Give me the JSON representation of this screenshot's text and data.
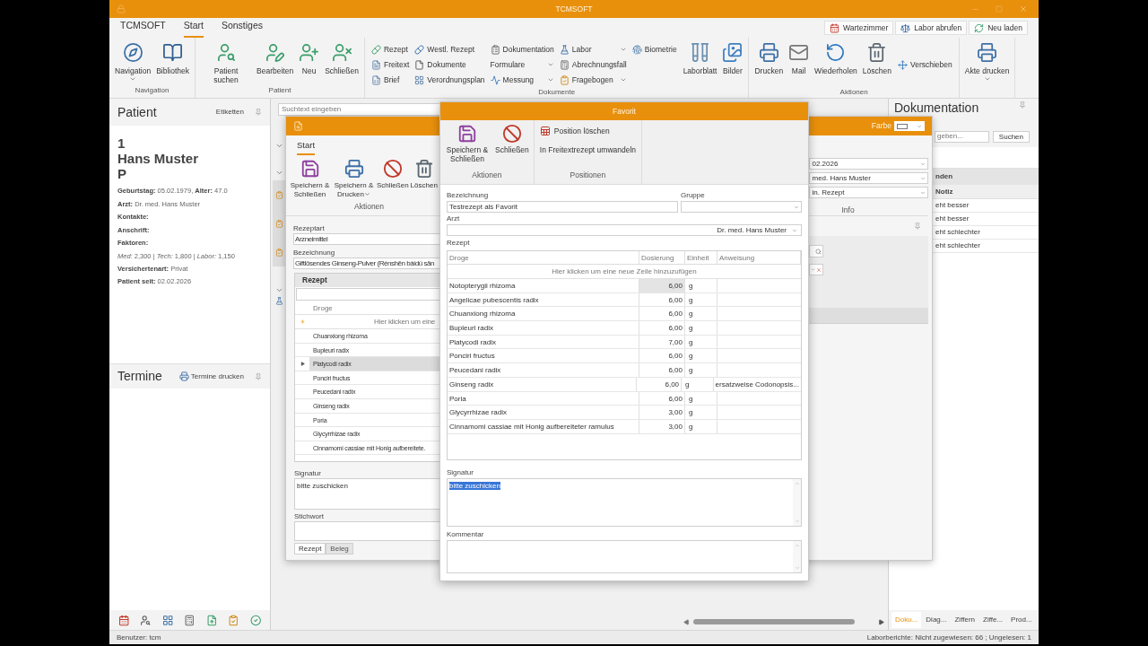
{
  "window": {
    "title": "TCMSOFT"
  },
  "ribbon": {
    "tabs": [
      {
        "label": "TCMSOFT",
        "selected": false
      },
      {
        "label": "Start",
        "selected": true
      },
      {
        "label": "Sonstiges",
        "selected": false
      }
    ],
    "quick_buttons": [
      {
        "label": "Wartezimmer"
      },
      {
        "label": "Labor abrufen"
      },
      {
        "label": "Neu laden"
      }
    ],
    "groups": [
      {
        "label": "Navigation",
        "items": [
          {
            "kind": "large",
            "label": "Navigation",
            "dropdown": true
          },
          {
            "kind": "large",
            "label": "Bibliothek",
            "dropdown": false
          }
        ]
      },
      {
        "label": "Patient",
        "items": [
          {
            "kind": "large",
            "label": "Patient suchen",
            "dropdown": false
          },
          {
            "kind": "large",
            "label": "Bearbeiten",
            "dropdown": false
          },
          {
            "kind": "large",
            "label": "Neu",
            "dropdown": false
          },
          {
            "kind": "large",
            "label": "Schließen",
            "dropdown": false
          }
        ]
      },
      {
        "label": "Dokumente",
        "items": [
          {
            "kind": "small",
            "label": "Rezept",
            "dropdown": false
          },
          {
            "kind": "small",
            "label": "Freitext",
            "dropdown": false
          },
          {
            "kind": "small",
            "label": "Brief",
            "dropdown": false
          },
          {
            "kind": "small",
            "label": "Westl. Rezept",
            "dropdown": false
          },
          {
            "kind": "small",
            "label": "Dokumente",
            "dropdown": false
          },
          {
            "kind": "small",
            "label": "Verordnungsplan",
            "dropdown": false
          },
          {
            "kind": "small",
            "label": "Dokumentation",
            "dropdown": false
          },
          {
            "kind": "small",
            "label": "Formulare",
            "dropdown": true
          },
          {
            "kind": "small",
            "label": "Messung",
            "dropdown": true
          },
          {
            "kind": "small",
            "label": "Labor",
            "dropdown": true
          },
          {
            "kind": "small",
            "label": "Abrechnungsfall",
            "dropdown": false
          },
          {
            "kind": "small",
            "label": "Fragebogen",
            "dropdown": true
          },
          {
            "kind": "small",
            "label": "Biometrie",
            "dropdown": false
          },
          {
            "kind": "large",
            "label": "Laborblatt",
            "dropdown": false
          },
          {
            "kind": "large",
            "label": "Bilder",
            "dropdown": false
          }
        ]
      },
      {
        "label": "Aktionen",
        "items": [
          {
            "kind": "large",
            "label": "Drucken",
            "dropdown": false
          },
          {
            "kind": "large",
            "label": "Mail",
            "dropdown": false
          },
          {
            "kind": "large",
            "label": "Wiederholen",
            "dropdown": false
          },
          {
            "kind": "large",
            "label": "Löschen",
            "dropdown": false
          },
          {
            "kind": "small",
            "label": "Verschieben",
            "dropdown": false
          }
        ]
      },
      {
        "items": [
          {
            "kind": "large",
            "label": "Akte drucken",
            "dropdown": true
          }
        ]
      }
    ]
  },
  "patient_panel": {
    "title": "Patient",
    "action": "Etiketten",
    "number": "1",
    "name": "Hans Muster",
    "type": "P",
    "details": [
      {
        "kind": "field",
        "text": "**Geburtstag:** 05.02.1979, **Alter:** 47.0"
      },
      {
        "kind": "field",
        "text": "**Arzt:** Dr. med. Hans Muster"
      },
      {
        "kind": "field",
        "text": "**Kontakte:**"
      },
      {
        "kind": "field",
        "text": "**Anschrift:**"
      },
      {
        "kind": "field",
        "text": "**Faktoren:**"
      },
      {
        "kind": "continuation",
        "text": "*Med:* 2,300 | *Tech:* 1,800 | *Labor:* 1,150"
      },
      {
        "kind": "field",
        "text": "**Versichertenart:** Privat"
      },
      {
        "kind": "field",
        "text": "**Patient seit:** 02.02.2026"
      }
    ]
  },
  "appointments_panel": {
    "title": "Termine",
    "action": "Termine drucken"
  },
  "center": {
    "search": {
      "placeholder": "Suchtext eingeben"
    }
  },
  "right_panel": {
    "title": "Dokumentation",
    "search": {
      "placeholder": "geben..."
    },
    "search_button": "Suchen",
    "group_header": "nden",
    "column": "Notiz",
    "rows": [
      "eht besser",
      "eht besser",
      "eht schlechter",
      "eht schlechter"
    ],
    "tabs": [
      {
        "label": "Doku...",
        "selected": true
      },
      {
        "label": "Diag...",
        "selected": false
      },
      {
        "label": "Ziffern",
        "selected": false
      },
      {
        "label": "Ziffe...",
        "selected": false
      },
      {
        "label": "Prod...",
        "selected": false
      }
    ]
  },
  "rezept_dialog": {
    "color_label": "Farbe",
    "tabs": [
      {
        "label": "Start",
        "selected": true
      }
    ],
    "actions": [
      {
        "label": "Speichern & Schließen",
        "dropdown": false
      },
      {
        "label": "Speichern & Drucken",
        "dropdown": true
      },
      {
        "label": "Schließen",
        "dropdown": false
      },
      {
        "label": "Löschen",
        "dropdown": false
      }
    ],
    "actions_group": "Aktionen",
    "fields": [
      {
        "label": "Rezeptart",
        "value": "Arzneimittel"
      },
      {
        "label": "Bezeichnung",
        "value": "Giftlösendes Ginseng-Pulver (Rénshēn bàidú sān"
      }
    ],
    "grid": {
      "title": "Rezept",
      "column": "Droge",
      "new_row": "Hier klicken um eine",
      "rows": [
        {
          "name": "Chuanxiong rhizoma",
          "selected": false
        },
        {
          "name": "Bupleuri radix",
          "selected": false
        },
        {
          "name": "Platycodi radix",
          "selected": true
        },
        {
          "name": "Ponciri fructus",
          "selected": false
        },
        {
          "name": "Peucedani radix",
          "selected": false
        },
        {
          "name": "Ginseng radix",
          "selected": false
        },
        {
          "name": "Poria",
          "selected": false
        },
        {
          "name": "Glycyrrhizae radix",
          "selected": false
        },
        {
          "name": "Cinnamomi cassiae mit Honig aufbereitete.",
          "selected": false
        }
      ]
    },
    "signatur": {
      "label": "Signatur",
      "value": "bitte zuschicken"
    },
    "stichwort": {
      "label": "Stichwort"
    },
    "bottom_tabs": [
      {
        "label": "Rezept",
        "selected": true
      },
      {
        "label": "Beleg",
        "selected": false
      }
    ],
    "side_fields": [
      "02.2026",
      "med. Hans Muster",
      "in. Rezept"
    ],
    "info_group": "Info"
  },
  "favorit_dialog": {
    "title": "Favorit",
    "groups": [
      {
        "label": "Aktionen",
        "items": [
          {
            "kind": "large",
            "label": "Speichern & Schließen"
          },
          {
            "kind": "large",
            "label": "Schließen"
          }
        ]
      },
      {
        "label": "Positionen",
        "items": [
          {
            "kind": "small",
            "label": "Position löschen"
          },
          {
            "kind": "text",
            "label": "In Freitextrezept umwandeln"
          }
        ]
      }
    ],
    "bezeichnung": {
      "label": "Bezeichnung",
      "value": "Testrezept als Favorit"
    },
    "gruppe": {
      "label": "Gruppe"
    },
    "arzt": {
      "label": "Arzt",
      "value": "Dr. med. Hans Muster"
    },
    "grid": {
      "label": "Rezept",
      "columns": [
        "Droge",
        "Dosierung",
        "Einheit",
        "Anweisung"
      ],
      "new_row": "Hier klicken um eine neue Zeile hinzuzufügen",
      "rows": [
        {
          "droge": "Notopterygii rhizoma",
          "dosierung": "6,00",
          "einheit": "g",
          "focused": true
        },
        {
          "droge": "Angelicae pubescentis radix",
          "dosierung": "6,00",
          "einheit": "g",
          "focused": false
        },
        {
          "droge": "Chuanxiong rhizoma",
          "dosierung": "6,00",
          "einheit": "g",
          "focused": false
        },
        {
          "droge": "Bupleuri radix",
          "dosierung": "6,00",
          "einheit": "g",
          "focused": false
        },
        {
          "droge": "Platycodi radix",
          "dosierung": "7,00",
          "einheit": "g",
          "focused": false
        },
        {
          "droge": "Ponciri fructus",
          "dosierung": "6,00",
          "einheit": "g",
          "focused": false
        },
        {
          "droge": "Peucedani radix",
          "dosierung": "6,00",
          "einheit": "g",
          "focused": false
        },
        {
          "droge": "Ginseng radix",
          "dosierung": "6,00",
          "einheit": "g",
          "anweisung": "ersatzweise Codonopsis...",
          "focused": false
        },
        {
          "droge": "Poria",
          "dosierung": "6,00",
          "einheit": "g",
          "focused": false
        },
        {
          "droge": "Glycyrrhizae radix",
          "dosierung": "3,00",
          "einheit": "g",
          "focused": false
        },
        {
          "droge": "Cinnamomi cassiae mit Honig aufbereiteter ramulus",
          "dosierung": "3,00",
          "einheit": "g",
          "focused": false
        }
      ]
    },
    "signatur": {
      "label": "Signatur",
      "value": "bitte zuschicken",
      "selected": true
    },
    "kommentar": {
      "label": "Kommentar"
    }
  },
  "status_bar": {
    "user": "Benutzer: tcm",
    "lab": "Laborberichte: Nicht zugewiesen: 66 ; Ungelesen: 1"
  }
}
